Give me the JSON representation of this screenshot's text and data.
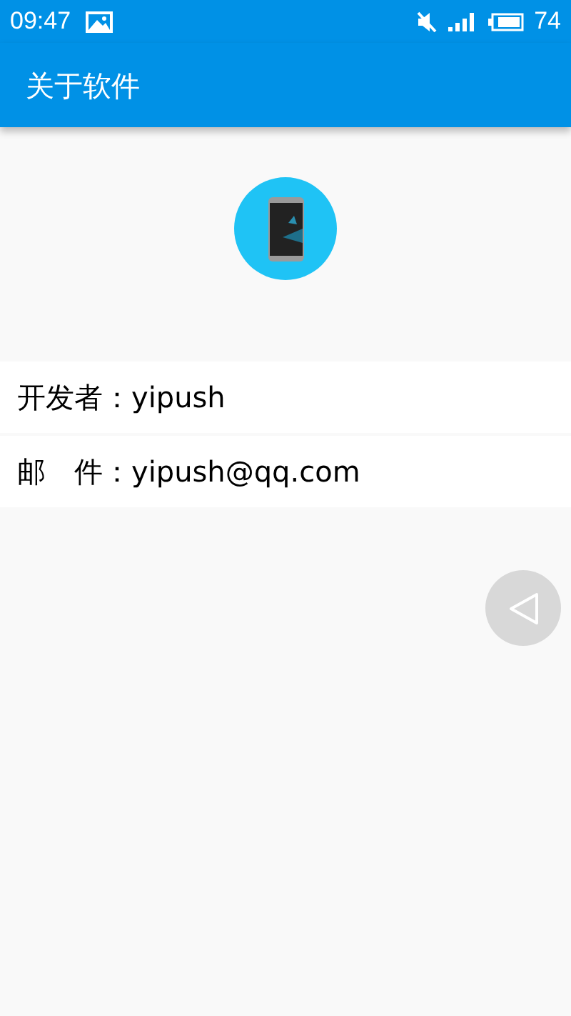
{
  "status_bar": {
    "time": "09:47",
    "battery": "74"
  },
  "app_bar": {
    "title": "关于软件"
  },
  "info_rows": [
    {
      "text": "开发者：yipush"
    },
    {
      "text": "邮　件：yipush@qq.com"
    }
  ]
}
